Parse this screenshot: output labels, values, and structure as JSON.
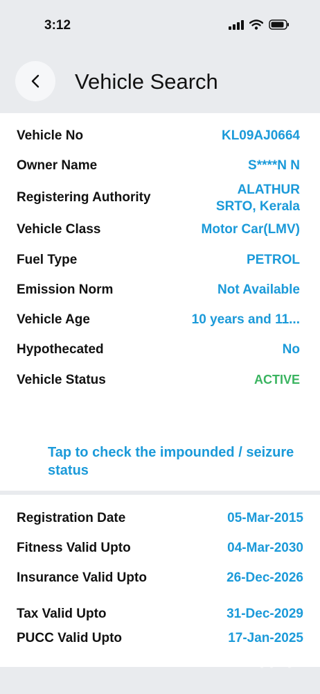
{
  "status_bar": {
    "time": "3:12"
  },
  "header": {
    "title": "Vehicle Search"
  },
  "details": [
    {
      "label": "Vehicle No",
      "value": "KL09AJ0664"
    },
    {
      "label": "Owner Name",
      "value": "S****N N"
    },
    {
      "label": "Registering Authority",
      "value_line1": "ALATHUR",
      "value_line2": "SRTO, Kerala"
    },
    {
      "label": "Vehicle Class",
      "value": "Motor Car(LMV)"
    },
    {
      "label": "Fuel Type",
      "value": "PETROL"
    },
    {
      "label": "Emission Norm",
      "value": "Not Available"
    },
    {
      "label": "Vehicle Age",
      "value": "10 years and 11..."
    },
    {
      "label": "Hypothecated",
      "value": "No"
    },
    {
      "label": "Vehicle Status",
      "value": "ACTIVE"
    }
  ],
  "impound_link": "Tap to check the impounded / seizure status",
  "validity": [
    {
      "label": "Registration Date",
      "value": "05-Mar-2015"
    },
    {
      "label": "Fitness Valid Upto",
      "value": "04-Mar-2030"
    },
    {
      "label": "Insurance Valid Upto",
      "value": "26-Dec-2026"
    },
    {
      "label": "Tax Valid Upto",
      "value": "31-Dec-2029"
    },
    {
      "label": "PUCC Valid Upto",
      "value": "17-Jan-2025"
    }
  ],
  "colors": {
    "accent": "#1b9ad9",
    "status_active": "#3ab460"
  },
  "watermark": "OLX"
}
